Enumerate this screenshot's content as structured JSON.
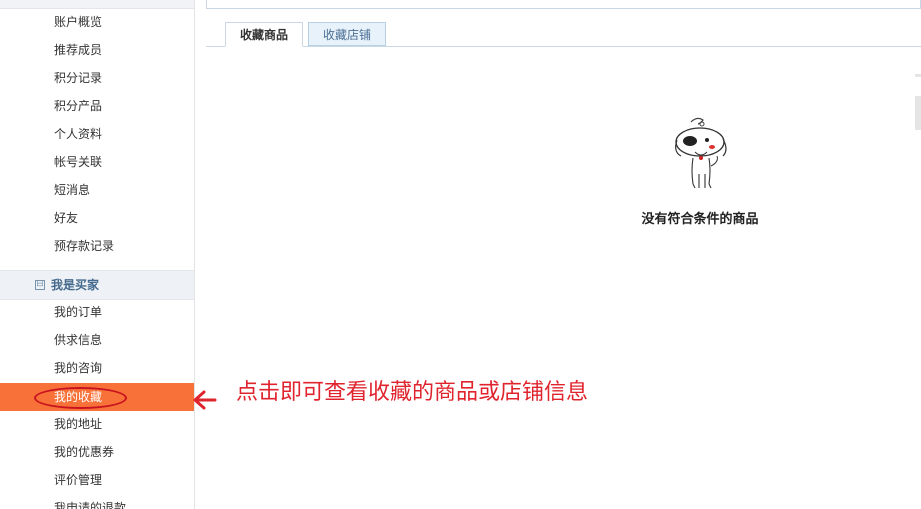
{
  "sidebar": {
    "account_items": [
      "账户概览",
      "推荐成员",
      "积分记录",
      "积分产品",
      "个人资料",
      "帐号关联",
      "短消息",
      "好友",
      "预存款记录"
    ],
    "section_title": "我是买家",
    "section_toggle": "⊟",
    "buyer_items": [
      "我的订单",
      "供求信息",
      "我的咨询",
      "我的收藏",
      "我的地址",
      "我的优惠券",
      "评价管理",
      "我申请的退款"
    ],
    "active_item": "我的收藏",
    "active_color": "#f87138"
  },
  "tabs": [
    {
      "label": "收藏商品",
      "active": true
    },
    {
      "label": "收藏店铺",
      "active": false
    }
  ],
  "empty_state": {
    "icon": "dog-mascot-icon",
    "message": "没有符合条件的商品"
  },
  "annotation": {
    "text": "点击即可查看收藏的商品或店铺信息",
    "color": "#e0242e",
    "arrow_icon": "left-arrow-icon"
  }
}
